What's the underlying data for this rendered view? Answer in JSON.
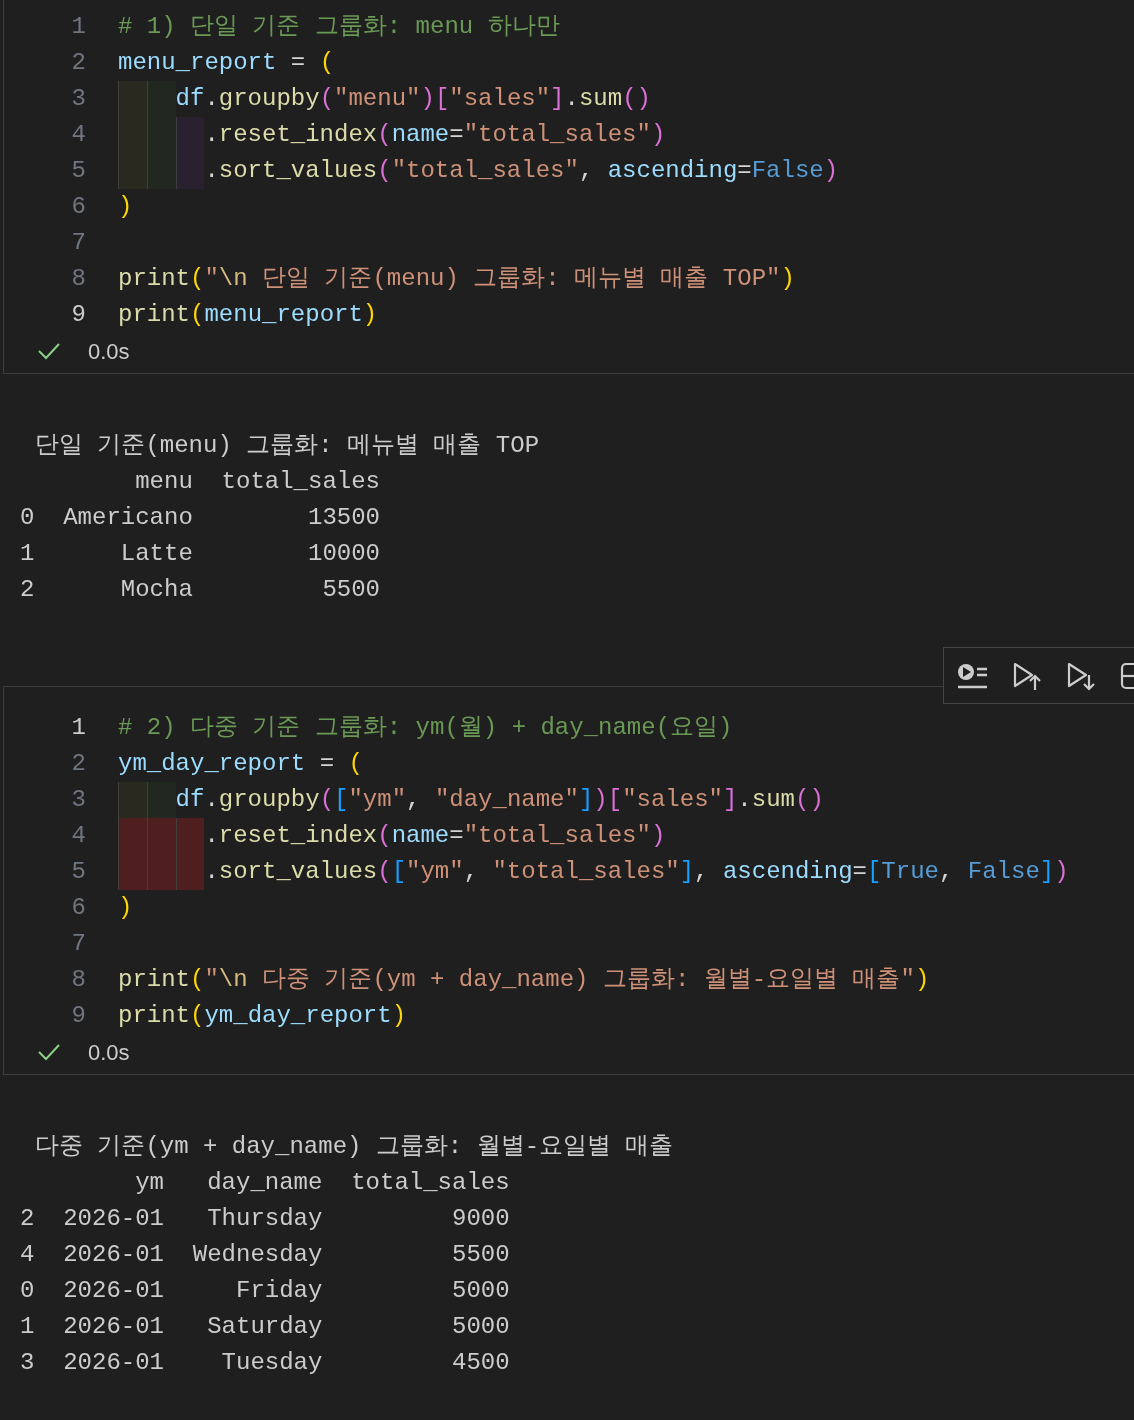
{
  "cells": [
    {
      "code_lines": [
        {
          "number": "1",
          "active": false,
          "kind": "top",
          "tokens": [
            {
              "kind": "comment",
              "text": "# 1) 단일 기준 그룹화: menu 하나만"
            }
          ]
        },
        {
          "number": "2",
          "active": false,
          "kind": "top",
          "tokens": [
            {
              "kind": "var",
              "text": "menu_report"
            },
            {
              "kind": "plain",
              "text": " = "
            },
            {
              "kind": "b1",
              "text": "("
            }
          ]
        },
        {
          "number": "3",
          "active": false,
          "kind": "body",
          "indent_error": false,
          "tokens": [
            {
              "kind": "var",
              "text": "df"
            },
            {
              "kind": "plain",
              "text": "."
            },
            {
              "kind": "fn",
              "text": "groupby"
            },
            {
              "kind": "b2",
              "text": "("
            },
            {
              "kind": "str",
              "text": "\"menu\""
            },
            {
              "kind": "b2",
              "text": ")"
            },
            {
              "kind": "b2",
              "text": "["
            },
            {
              "kind": "str",
              "text": "\"sales\""
            },
            {
              "kind": "b2",
              "text": "]"
            },
            {
              "kind": "plain",
              "text": "."
            },
            {
              "kind": "fn",
              "text": "sum"
            },
            {
              "kind": "b2",
              "text": "()"
            }
          ]
        },
        {
          "number": "4",
          "active": false,
          "kind": "nested",
          "indent_error": false,
          "tokens": [
            {
              "kind": "plain",
              "text": "."
            },
            {
              "kind": "fn",
              "text": "reset_index"
            },
            {
              "kind": "b2",
              "text": "("
            },
            {
              "kind": "var",
              "text": "name"
            },
            {
              "kind": "plain",
              "text": "="
            },
            {
              "kind": "str",
              "text": "\"total_sales\""
            },
            {
              "kind": "b2",
              "text": ")"
            }
          ]
        },
        {
          "number": "5",
          "active": false,
          "kind": "nested",
          "indent_error": false,
          "tokens": [
            {
              "kind": "plain",
              "text": "."
            },
            {
              "kind": "fn",
              "text": "sort_values"
            },
            {
              "kind": "b2",
              "text": "("
            },
            {
              "kind": "str",
              "text": "\"total_sales\""
            },
            {
              "kind": "plain",
              "text": ", "
            },
            {
              "kind": "var",
              "text": "ascending"
            },
            {
              "kind": "plain",
              "text": "="
            },
            {
              "kind": "const",
              "text": "False"
            },
            {
              "kind": "b2",
              "text": ")"
            }
          ]
        },
        {
          "number": "6",
          "active": false,
          "kind": "top",
          "tokens": [
            {
              "kind": "b1",
              "text": ")"
            }
          ]
        },
        {
          "number": "7",
          "active": false,
          "kind": "top"
        },
        {
          "number": "8",
          "active": false,
          "kind": "top",
          "tokens": [
            {
              "kind": "fn",
              "text": "print"
            },
            {
              "kind": "b1",
              "text": "("
            },
            {
              "kind": "str",
              "text": "\""
            },
            {
              "kind": "esc",
              "text": "\\n"
            },
            {
              "kind": "str",
              "text": " 단일 기준(menu) 그룹화: 메뉴별 매출 TOP\""
            },
            {
              "kind": "b1",
              "text": ")"
            }
          ]
        },
        {
          "number": "9",
          "active": true,
          "kind": "top",
          "tokens": [
            {
              "kind": "fn",
              "text": "print"
            },
            {
              "kind": "b1",
              "text": "("
            },
            {
              "kind": "var",
              "text": "menu_report"
            },
            {
              "kind": "b1",
              "text": ")"
            }
          ]
        }
      ],
      "status": {
        "succeeded": true,
        "time": "0.0s"
      },
      "output": {
        "title": "단일 기준(menu) 그룹화: 메뉴별 매출 TOP",
        "columns": [
          "menu",
          "total_sales"
        ],
        "rows": [
          {
            "index": "0",
            "cells": [
              "Americano",
              "13500"
            ]
          },
          {
            "index": "1",
            "cells": [
              "Latte",
              "10000"
            ]
          },
          {
            "index": "2",
            "cells": [
              "Mocha",
              "5500"
            ]
          }
        ]
      }
    },
    {
      "toolbar": true,
      "code_lines": [
        {
          "number": "1",
          "active": true,
          "kind": "top",
          "tokens": [
            {
              "kind": "comment",
              "text": "# 2) 다중 기준 그룹화: ym(월) + day_name(요일)"
            }
          ]
        },
        {
          "number": "2",
          "active": false,
          "kind": "top",
          "tokens": [
            {
              "kind": "var",
              "text": "ym_day_report"
            },
            {
              "kind": "plain",
              "text": " = "
            },
            {
              "kind": "b1",
              "text": "("
            }
          ]
        },
        {
          "number": "3",
          "active": false,
          "kind": "body",
          "indent_error": false,
          "tokens": [
            {
              "kind": "var",
              "text": "df"
            },
            {
              "kind": "plain",
              "text": "."
            },
            {
              "kind": "fn",
              "text": "groupby"
            },
            {
              "kind": "b2",
              "text": "("
            },
            {
              "kind": "b3",
              "text": "["
            },
            {
              "kind": "str",
              "text": "\"ym\""
            },
            {
              "kind": "plain",
              "text": ", "
            },
            {
              "kind": "str",
              "text": "\"day_name\""
            },
            {
              "kind": "b3",
              "text": "]"
            },
            {
              "kind": "b2",
              "text": ")"
            },
            {
              "kind": "b2",
              "text": "["
            },
            {
              "kind": "str",
              "text": "\"sales\""
            },
            {
              "kind": "b2",
              "text": "]"
            },
            {
              "kind": "plain",
              "text": "."
            },
            {
              "kind": "fn",
              "text": "sum"
            },
            {
              "kind": "b2",
              "text": "()"
            }
          ]
        },
        {
          "number": "4",
          "active": false,
          "kind": "nested",
          "indent_error": true,
          "tokens": [
            {
              "kind": "plain",
              "text": "."
            },
            {
              "kind": "fn",
              "text": "reset_index"
            },
            {
              "kind": "b2",
              "text": "("
            },
            {
              "kind": "var",
              "text": "name"
            },
            {
              "kind": "plain",
              "text": "="
            },
            {
              "kind": "str",
              "text": "\"total_sales\""
            },
            {
              "kind": "b2",
              "text": ")"
            }
          ]
        },
        {
          "number": "5",
          "active": false,
          "kind": "nested",
          "indent_error": true,
          "tokens": [
            {
              "kind": "plain",
              "text": "."
            },
            {
              "kind": "fn",
              "text": "sort_values"
            },
            {
              "kind": "b2",
              "text": "("
            },
            {
              "kind": "b3",
              "text": "["
            },
            {
              "kind": "str",
              "text": "\"ym\""
            },
            {
              "kind": "plain",
              "text": ", "
            },
            {
              "kind": "str",
              "text": "\"total_sales\""
            },
            {
              "kind": "b3",
              "text": "]"
            },
            {
              "kind": "plain",
              "text": ", "
            },
            {
              "kind": "var",
              "text": "ascending"
            },
            {
              "kind": "plain",
              "text": "="
            },
            {
              "kind": "b3",
              "text": "["
            },
            {
              "kind": "const",
              "text": "True"
            },
            {
              "kind": "plain",
              "text": ", "
            },
            {
              "kind": "const",
              "text": "False"
            },
            {
              "kind": "b3",
              "text": "]"
            },
            {
              "kind": "b2",
              "text": ")"
            }
          ]
        },
        {
          "number": "6",
          "active": false,
          "kind": "top",
          "tokens": [
            {
              "kind": "b1",
              "text": ")"
            }
          ]
        },
        {
          "number": "7",
          "active": false,
          "kind": "top"
        },
        {
          "number": "8",
          "active": false,
          "kind": "top",
          "tokens": [
            {
              "kind": "fn",
              "text": "print"
            },
            {
              "kind": "b1",
              "text": "("
            },
            {
              "kind": "str",
              "text": "\""
            },
            {
              "kind": "esc",
              "text": "\\n"
            },
            {
              "kind": "str",
              "text": " 다중 기준(ym + day_name) 그룹화: 월별-요일별 매출\""
            },
            {
              "kind": "b1",
              "text": ")"
            }
          ]
        },
        {
          "number": "9",
          "active": false,
          "kind": "top",
          "tokens": [
            {
              "kind": "fn",
              "text": "print"
            },
            {
              "kind": "b1",
              "text": "("
            },
            {
              "kind": "var",
              "text": "ym_day_report"
            },
            {
              "kind": "b1",
              "text": ")"
            }
          ]
        }
      ],
      "status": {
        "succeeded": true,
        "time": "0.0s"
      },
      "output": {
        "title": "다중 기준(ym + day_name) 그룹화: 월별-요일별 매출",
        "columns": [
          "ym",
          "day_name",
          "total_sales"
        ],
        "rows": [
          {
            "index": "2",
            "cells": [
              "2026-01",
              "Thursday",
              "9000"
            ]
          },
          {
            "index": "4",
            "cells": [
              "2026-01",
              "Wednesday",
              "5500"
            ]
          },
          {
            "index": "0",
            "cells": [
              "2026-01",
              "Friday",
              "5000"
            ]
          },
          {
            "index": "1",
            "cells": [
              "2026-01",
              "Saturday",
              "5000"
            ]
          },
          {
            "index": "3",
            "cells": [
              "2026-01",
              "Tuesday",
              "4500"
            ]
          }
        ]
      }
    }
  ]
}
